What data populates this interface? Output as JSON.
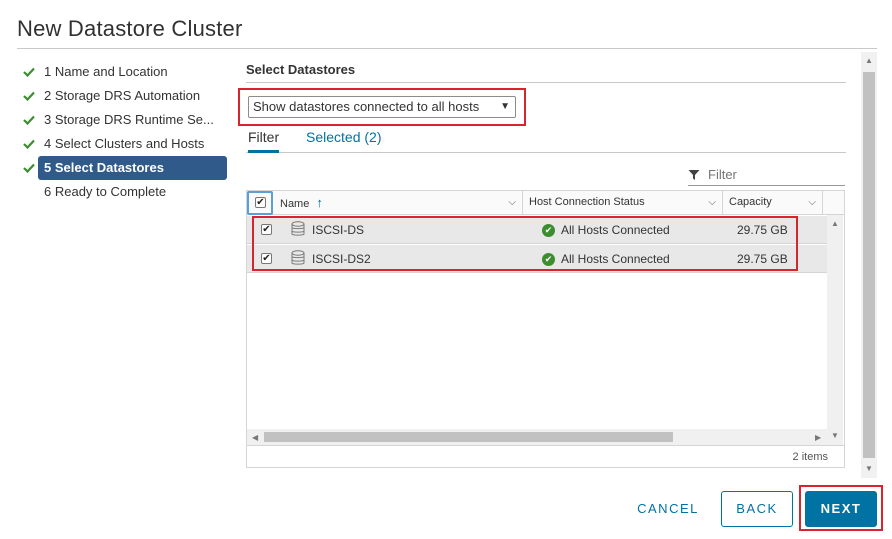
{
  "dialog": {
    "title": "New Datastore Cluster"
  },
  "steps": [
    {
      "label": "1 Name and Location",
      "done": true
    },
    {
      "label": "2 Storage DRS Automation",
      "done": true
    },
    {
      "label": "3 Storage DRS Runtime Se...",
      "done": true
    },
    {
      "label": "4 Select Clusters and Hosts",
      "done": true
    },
    {
      "label": "5 Select Datastores",
      "done": true,
      "active": true
    },
    {
      "label": "6 Ready to Complete",
      "done": false
    }
  ],
  "section": {
    "title": "Select Datastores"
  },
  "datastore_filter": {
    "selected": "Show datastores connected to all hosts"
  },
  "tabs": [
    {
      "label": "Filter",
      "active": true
    },
    {
      "label": "Selected (2)",
      "active": false
    }
  ],
  "filter_input": {
    "placeholder": "Filter",
    "value": ""
  },
  "grid": {
    "columns": [
      "Name",
      "Host Connection Status",
      "Capacity"
    ],
    "sort_indicator": "↑",
    "rows": [
      {
        "checked": true,
        "name": "ISCSI-DS",
        "status": "All Hosts Connected",
        "capacity": "29.75 GB"
      },
      {
        "checked": true,
        "name": "ISCSI-DS2",
        "status": "All Hosts Connected",
        "capacity": "29.75 GB"
      }
    ],
    "footer": "2 items"
  },
  "buttons": {
    "cancel": "CANCEL",
    "back": "BACK",
    "next": "NEXT"
  },
  "colors": {
    "accent": "#0072a3",
    "active_step": "#2f5a8a",
    "highlight": "#d9232e",
    "status_ok": "#3c8d2f"
  }
}
